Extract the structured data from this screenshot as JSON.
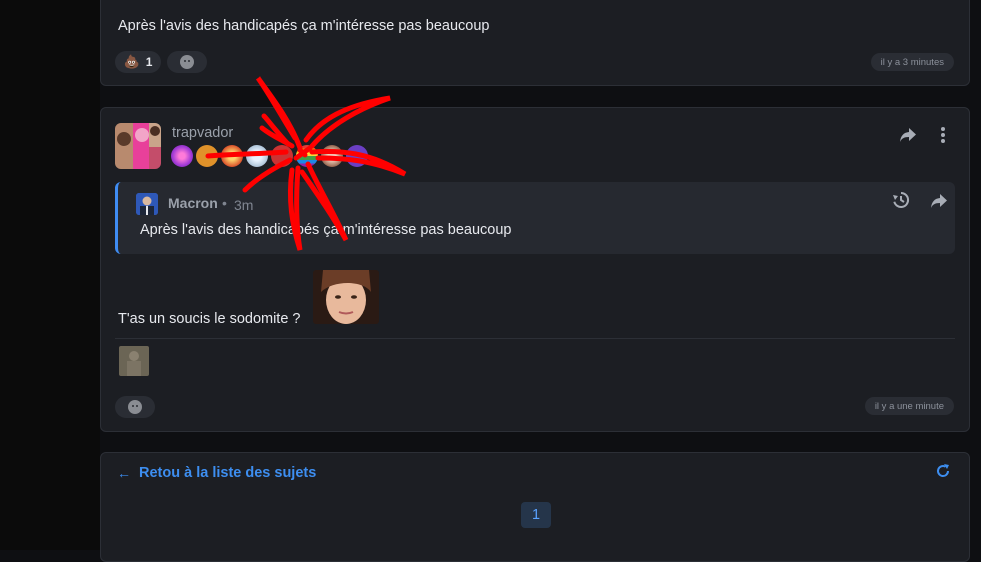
{
  "post_top": {
    "text": "Après l'avis des handicapés ça m'intéresse pas beaucoup",
    "reactions": [
      {
        "icon": "poop-emoji-icon",
        "count": "1"
      },
      {
        "icon": "add-reaction-icon",
        "count": ""
      }
    ],
    "time": "il y a 3 minutes"
  },
  "post_main": {
    "username": "trapvador",
    "badges": [
      "spiral-badge",
      "orange-hex-badge",
      "burst-badge",
      "cloud-badge",
      "dot-badge",
      "rainbow-badge",
      "fox-badge",
      "purple-hex-badge"
    ],
    "quote": {
      "author": "Macron",
      "separator": "•",
      "time": "3m",
      "text": "Après l'avis des handicapés ça m'intéresse pas beaucoup"
    },
    "text": "T'as un soucis le sodomite ?",
    "reaction_icon": "add-reaction-icon",
    "time": "il y a une minute"
  },
  "footer": {
    "back_label": "Retou à la liste des sujets",
    "page": "1"
  },
  "colors": {
    "accent": "#3d8ef0",
    "annotation": "#ff0000",
    "card_bg": "#1c1e23"
  }
}
